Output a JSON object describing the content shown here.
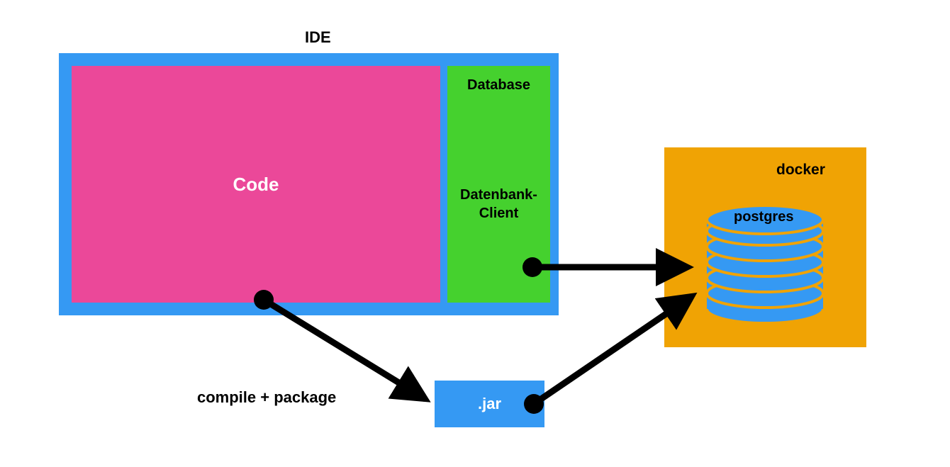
{
  "labels": {
    "ide": "IDE",
    "code": "Code",
    "database": "Database",
    "db_client": "Datenbank-Client",
    "jar": ".jar",
    "docker": "docker",
    "postgres": "postgres",
    "compile_package": "compile + package"
  },
  "colors": {
    "blue": "#3599f3",
    "pink": "#eb4899",
    "green": "#45d12e",
    "orange": "#f0a304",
    "black": "#000000"
  },
  "diagram": {
    "nodes": [
      {
        "id": "ide",
        "type": "container"
      },
      {
        "id": "code",
        "type": "box",
        "parent": "ide"
      },
      {
        "id": "database_client",
        "type": "box",
        "parent": "ide"
      },
      {
        "id": "jar",
        "type": "box"
      },
      {
        "id": "docker",
        "type": "container"
      },
      {
        "id": "postgres",
        "type": "database",
        "parent": "docker"
      }
    ],
    "edges": [
      {
        "from": "code",
        "to": "jar",
        "label": "compile + package"
      },
      {
        "from": "database_client",
        "to": "postgres"
      },
      {
        "from": "jar",
        "to": "postgres"
      }
    ]
  }
}
